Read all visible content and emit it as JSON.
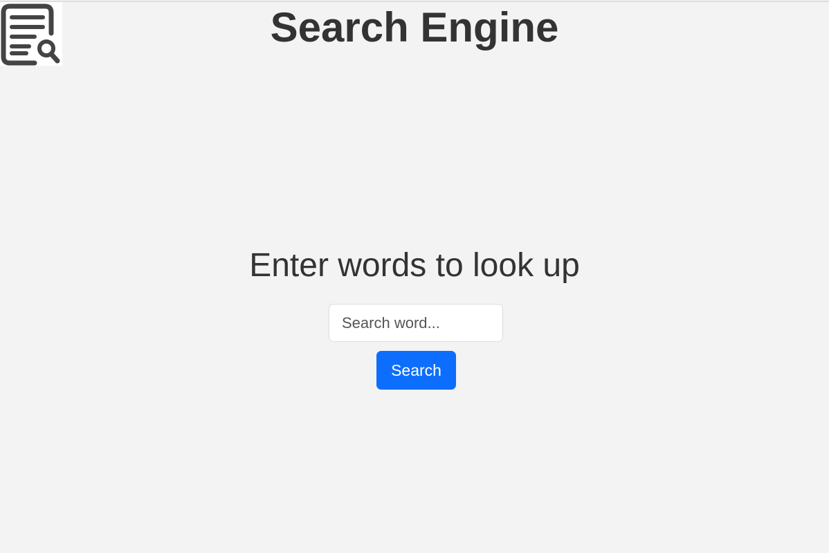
{
  "header": {
    "title": "Search Engine",
    "logo_icon": "document-search-icon"
  },
  "main": {
    "prompt": "Enter words to look up",
    "search": {
      "value": "",
      "placeholder": "Search word..."
    },
    "search_button_label": "Search"
  },
  "colors": {
    "background": "#f3f3f3",
    "text": "#333333",
    "accent": "#0d6efd",
    "button_text": "#ffffff"
  }
}
